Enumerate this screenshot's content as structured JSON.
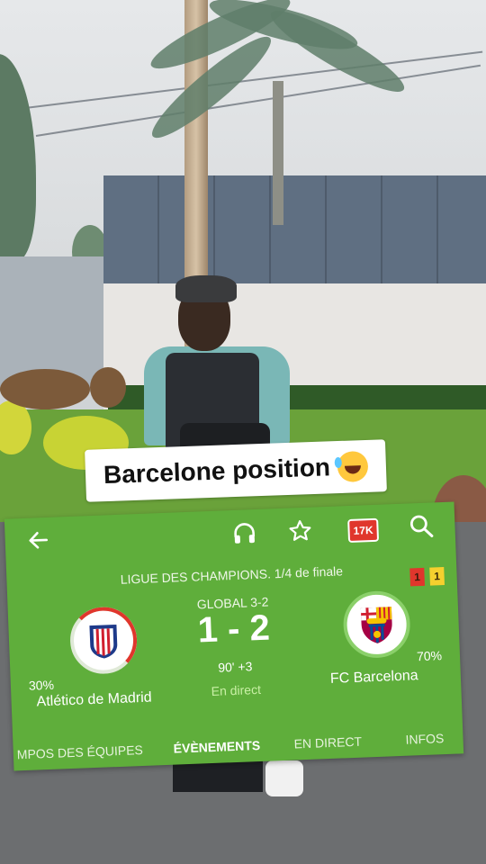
{
  "caption": {
    "text": "Barcelone position"
  },
  "toolbar": {
    "icons": [
      "back-arrow-icon",
      "headphones-icon",
      "star-icon",
      "views-badge-icon",
      "search-icon"
    ],
    "views_badge": "17K"
  },
  "match": {
    "competition": "LIGUE DES CHAMPIONS. 1/4 de finale",
    "aggregate": "GLOBAL 3-2",
    "score": "1 - 2",
    "minute": "90' +3",
    "status": "En direct",
    "cards": {
      "red": "1",
      "yellow": "1"
    },
    "home": {
      "name": "Atlético de Madrid",
      "possession": "30%"
    },
    "away": {
      "name": "FC Barcelona",
      "possession": "70%"
    }
  },
  "tabs": [
    "MPOS DES ÉQUIPES",
    "ÉVÈNEMENTS",
    "EN DIRECT",
    "INFOS"
  ],
  "active_tab": "ÉVÈNEMENTS",
  "colors": {
    "card_green": "#5fae3b",
    "live_green": "#c9f0a6",
    "badge_red": "#e0362c"
  }
}
